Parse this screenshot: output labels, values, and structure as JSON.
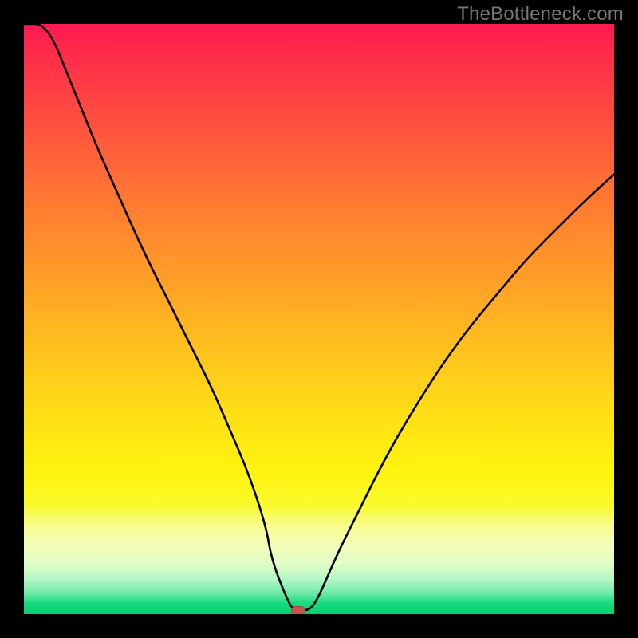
{
  "watermark": "TheBottleneck.com",
  "chart_data": {
    "type": "line",
    "title": "",
    "xlabel": "",
    "ylabel": "",
    "xlim": [
      0,
      1
    ],
    "ylim": [
      0,
      1
    ],
    "grid": false,
    "legend": false,
    "notes": "V-shaped bottleneck curve over traffic-light gradient (red top → green bottom). Left branch descends steeply to a flat minimum; right branch rises with diminishing slope. A single red rounded marker sits at the valley minimum.",
    "series": [
      {
        "name": "curve",
        "x": [
          0.0,
          0.039,
          0.08,
          0.12,
          0.16,
          0.2,
          0.24,
          0.28,
          0.32,
          0.35,
          0.38,
          0.41,
          0.42,
          0.45,
          0.46,
          0.47,
          0.485,
          0.5,
          0.53,
          0.57,
          0.61,
          0.65,
          0.7,
          0.75,
          0.8,
          0.85,
          0.9,
          0.95,
          1.0
        ],
        "y": [
          1.0,
          1.0,
          0.9,
          0.8,
          0.71,
          0.62,
          0.54,
          0.46,
          0.38,
          0.31,
          0.24,
          0.15,
          0.09,
          0.015,
          0.007,
          0.007,
          0.007,
          0.03,
          0.1,
          0.18,
          0.26,
          0.33,
          0.41,
          0.48,
          0.54,
          0.6,
          0.65,
          0.7,
          0.745
        ]
      }
    ],
    "marker": {
      "x": 0.465,
      "y": 0.006
    },
    "background_gradient": {
      "top": "#ff1a50",
      "mid": "#ffe314",
      "bottom": "#00d070"
    }
  }
}
